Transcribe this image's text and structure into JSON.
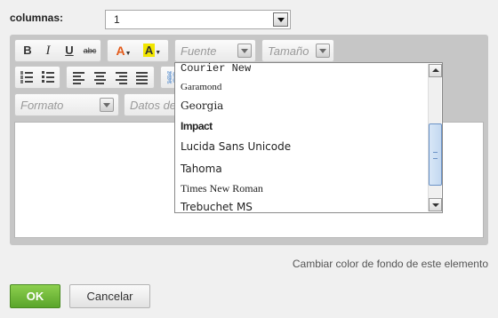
{
  "columns": {
    "label": "columnas:",
    "value": "1"
  },
  "toolbar": {
    "bold": "B",
    "italic": "I",
    "underline": "U",
    "strike": "abc",
    "text_color_glyph": "A",
    "bg_color_glyph": "A",
    "font_label": "Fuente",
    "size_label": "Tamaño",
    "format_label": "Formato",
    "datos_label": "Datos del"
  },
  "font_options": [
    "Courier New",
    "Garamond",
    "Georgia",
    "Impact",
    "Lucida Sans Unicode",
    "Tahoma",
    "Times New Roman",
    "Trebuchet MS"
  ],
  "bg_color_link": "Cambiar color de fondo de este elemento",
  "buttons": {
    "ok": "OK",
    "cancel": "Cancelar"
  },
  "colors": {
    "ok_button": "#6cb83a",
    "scroll_thumb": "#c3d8f0",
    "text_color_icon": "#e35a1a",
    "bg_color_icon": "#f2e600"
  }
}
